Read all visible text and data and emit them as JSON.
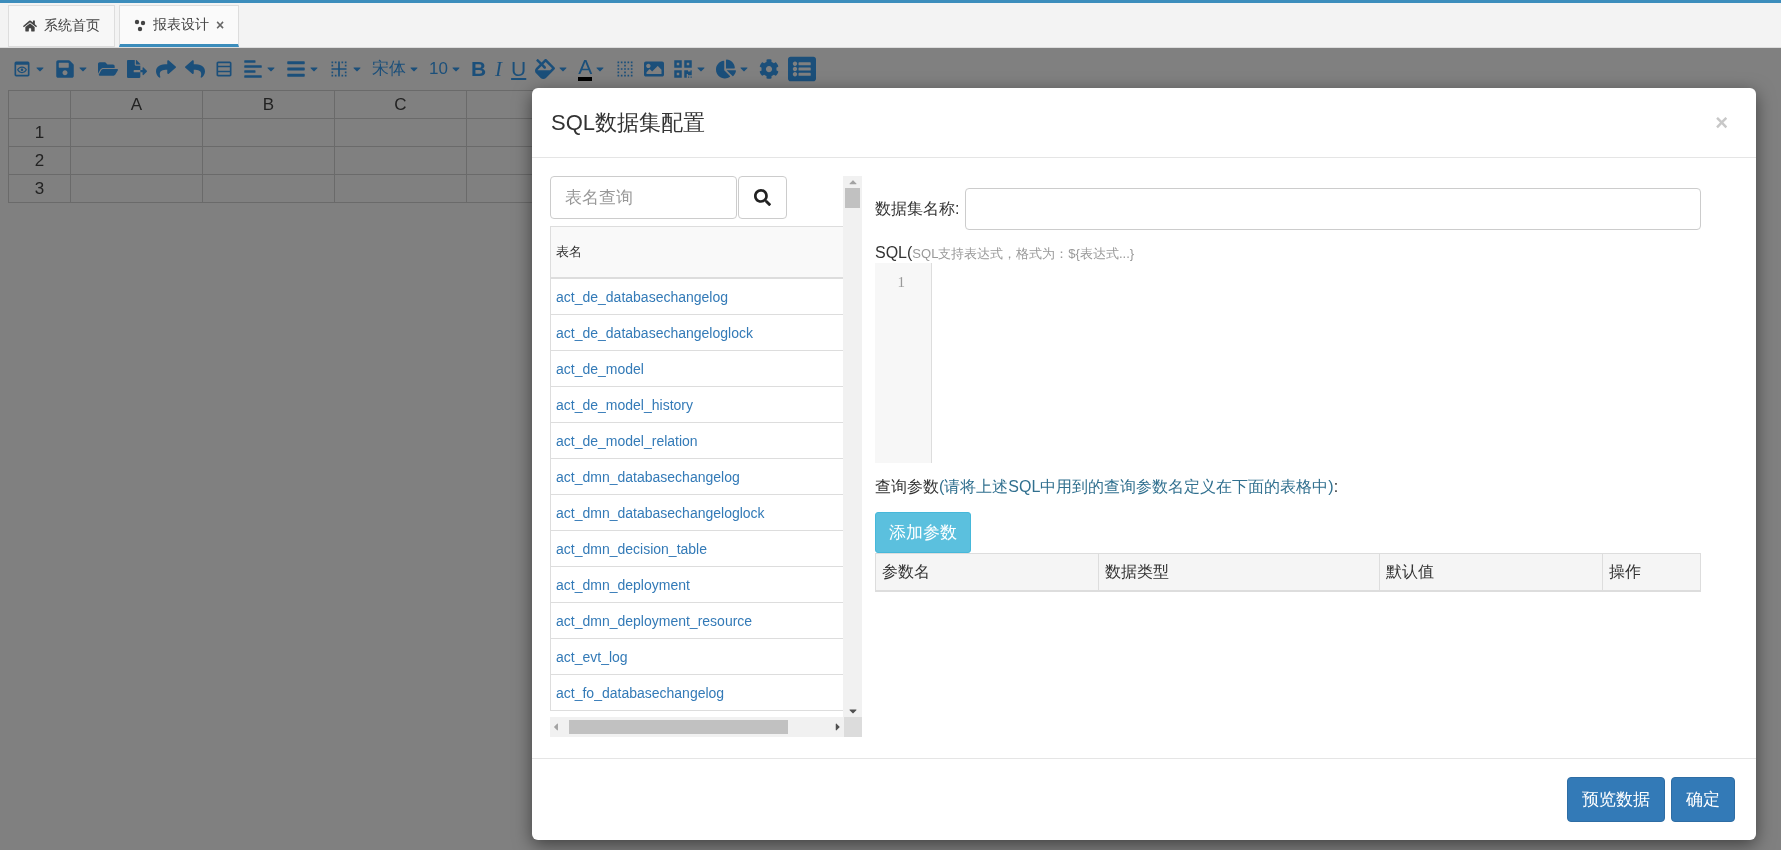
{
  "tabs": [
    {
      "label": "系统首页",
      "selected": false,
      "closable": false
    },
    {
      "label": "报表设计",
      "selected": true,
      "closable": true,
      "close": "×"
    }
  ],
  "toolbar": [
    {
      "kind": "icon",
      "caret": true
    },
    {
      "kind": "icon",
      "caret": true
    },
    {
      "kind": "icon",
      "caret": false
    },
    {
      "kind": "icon",
      "caret": false
    },
    {
      "kind": "icon",
      "caret": false
    },
    {
      "kind": "icon",
      "caret": false
    },
    {
      "kind": "icon",
      "caret": false
    },
    {
      "kind": "icon",
      "caret": true
    },
    {
      "kind": "icon",
      "caret": true
    },
    {
      "kind": "icon",
      "caret": true
    },
    {
      "kind": "font",
      "label": "宋体",
      "caret": true
    },
    {
      "kind": "font",
      "label": "10",
      "caret": true
    },
    {
      "kind": "bold",
      "label": "B",
      "caret": false
    },
    {
      "kind": "italic",
      "label": "I",
      "caret": false
    },
    {
      "kind": "underline",
      "label": "U",
      "caret": false
    },
    {
      "kind": "icon",
      "caret": true
    },
    {
      "kind": "fontcolor",
      "label": "A",
      "caret": true
    },
    {
      "kind": "icon",
      "caret": false
    },
    {
      "kind": "icon",
      "caret": false
    },
    {
      "kind": "icon",
      "caret": true
    },
    {
      "kind": "icon",
      "caret": true
    },
    {
      "kind": "icon",
      "caret": false
    },
    {
      "kind": "icon",
      "caret": false
    }
  ],
  "sheet": {
    "columns": [
      "A",
      "B",
      "C"
    ],
    "rows": [
      "1",
      "2",
      "3"
    ]
  },
  "dialog": {
    "title": "SQL数据集配置",
    "close": "×",
    "search": {
      "placeholder": "表名查询"
    },
    "table_list": {
      "header": "表名",
      "rows": [
        "act_de_databasechangelog",
        "act_de_databasechangeloglock",
        "act_de_model",
        "act_de_model_history",
        "act_de_model_relation",
        "act_dmn_databasechangelog",
        "act_dmn_databasechangeloglock",
        "act_dmn_decision_table",
        "act_dmn_deployment",
        "act_dmn_deployment_resource",
        "act_evt_log",
        "act_fo_databasechangelog"
      ]
    },
    "name_label": "数据集名称:",
    "sql_label": "SQL(",
    "sql_hint": "SQL支持表达式，格式为：${表达式...}",
    "line_number": "1",
    "params_label": "查询参数",
    "params_hint": "(请将上述SQL中用到的查询参数名定义在下面的表格中)",
    "params_colon": ":",
    "add_button": "添加参数",
    "params_columns": [
      "参数名",
      "数据类型",
      "默认值",
      "操作"
    ],
    "buttons": [
      "预览数据",
      "确定"
    ]
  }
}
